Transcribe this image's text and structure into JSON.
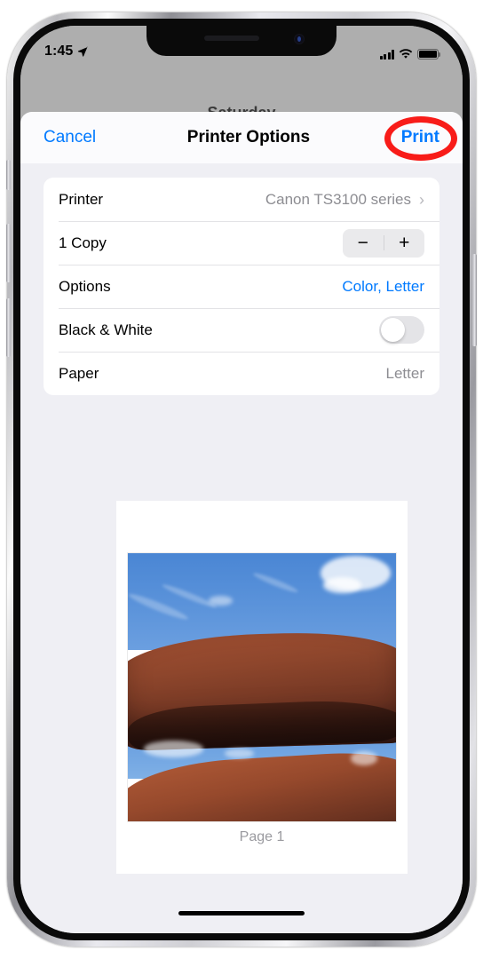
{
  "status_bar": {
    "time": "1:45",
    "location_icon": "location-arrow-icon",
    "cellular_icon": "signal-bars-icon",
    "wifi_icon": "wifi-icon",
    "battery_icon": "battery-icon"
  },
  "background_app": {
    "partial_title": "Saturday"
  },
  "sheet": {
    "cancel_label": "Cancel",
    "title": "Printer Options",
    "print_label": "Print",
    "highlight_color": "#f81c19",
    "accent_color": "#007aff"
  },
  "options": [
    {
      "label": "Printer",
      "value": "Canon TS3100 series",
      "type": "disclosure",
      "chevron": "›"
    },
    {
      "label": "1 Copy",
      "value": "",
      "type": "stepper",
      "minus": "−",
      "plus": "+"
    },
    {
      "label": "Options",
      "value": "Color, Letter",
      "type": "link"
    },
    {
      "label": "Black & White",
      "value": "",
      "type": "toggle",
      "state": "off"
    },
    {
      "label": "Paper",
      "value": "Letter",
      "type": "static"
    }
  ],
  "preview": {
    "caption": "Page 1",
    "photo_alt": "desert-rock-arch-photo"
  },
  "home_indicator": "home-indicator"
}
